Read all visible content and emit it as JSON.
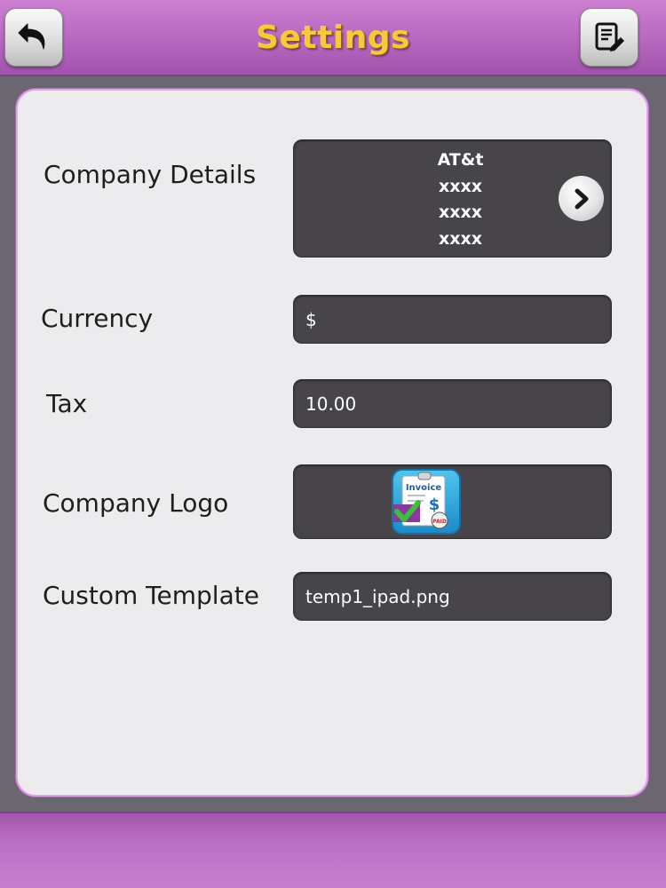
{
  "header": {
    "title": "Settings",
    "back_icon": "undo-arrow-icon",
    "edit_icon": "edit-document-icon"
  },
  "settings": {
    "company_details": {
      "label": "Company Details",
      "lines": [
        "AT&t",
        "xxxx",
        "xxxx",
        "xxxx"
      ],
      "arrow_icon": "chevron-right-icon"
    },
    "currency": {
      "label": "Currency",
      "value": "$"
    },
    "tax": {
      "label": "Tax",
      "value": "10.00"
    },
    "company_logo": {
      "label": "Company Logo",
      "image_icon": "invoice-app-logo-icon",
      "logo_text": "Invoice"
    },
    "custom_template": {
      "label": "Custom Template",
      "value": "temp1_ipad.png"
    }
  },
  "colors": {
    "header_purple": "#b767c0",
    "title_yellow": "#f7c93a",
    "field_dark": "#47444a",
    "panel_bg": "#ececee",
    "outer_bg": "#6b6770"
  }
}
